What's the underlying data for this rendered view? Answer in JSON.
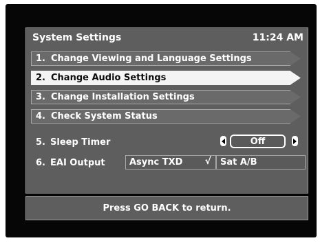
{
  "title": "System Settings",
  "clock": "11:24 AM",
  "menu": [
    {
      "num": "1.",
      "label": "Change Viewing and Language Settings",
      "selected": false
    },
    {
      "num": "2.",
      "label": "Change Audio Settings",
      "selected": true
    },
    {
      "num": "3.",
      "label": "Change Installation Settings",
      "selected": false
    },
    {
      "num": "4.",
      "label": "Check System Status",
      "selected": false
    }
  ],
  "sleep_timer": {
    "num": "5.",
    "label": "Sleep Timer",
    "value": "Off"
  },
  "eai_output": {
    "num": "6.",
    "label": "EAI Output",
    "options": [
      {
        "label": "Async TXD",
        "checked": true,
        "check_glyph": "√"
      },
      {
        "label": "Sat A/B",
        "checked": false
      }
    ]
  },
  "footer_text": "Press GO BACK to return."
}
